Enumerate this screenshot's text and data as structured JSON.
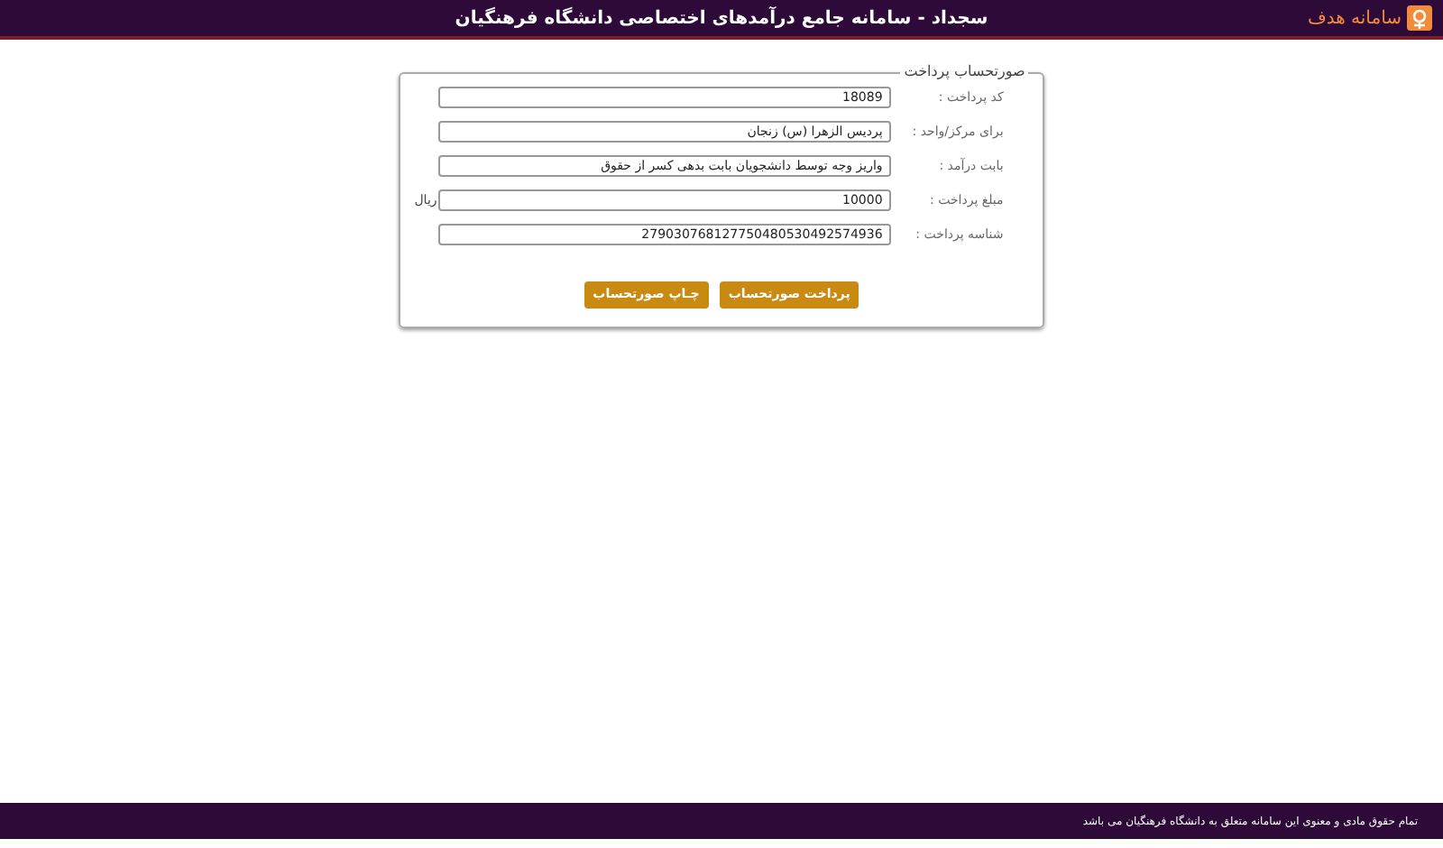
{
  "header": {
    "title": "سجداد - سامانه جامع درآمدهای اختصاصی دانشگاه فرهنگیان",
    "logo_text": "سامانه هدف"
  },
  "form": {
    "legend": "صورتحساب پرداخت",
    "fields": [
      {
        "label": "کد پرداخت :",
        "value": "18089"
      },
      {
        "label": "برای مرکز/واحد :",
        "value": "پردیس الزهرا (س) زنجان"
      },
      {
        "label": "بابت درآمد :",
        "value": "واریز وجه توسط دانشجویان بابت بدهی کسر از حقوق"
      },
      {
        "label": "مبلغ پرداخت :",
        "value": "10000",
        "unit": "ریال"
      },
      {
        "label": "شناسه پرداخت :",
        "value": "279030768127750480530492574936"
      }
    ],
    "buttons": [
      "پرداخت صورتحساب",
      "چـاپ صورتحساب"
    ]
  },
  "footer": {
    "text": "تمام حقوق مادی و معنوی این سامانه متعلق به دانشگاه فرهنگیان می باشد"
  }
}
